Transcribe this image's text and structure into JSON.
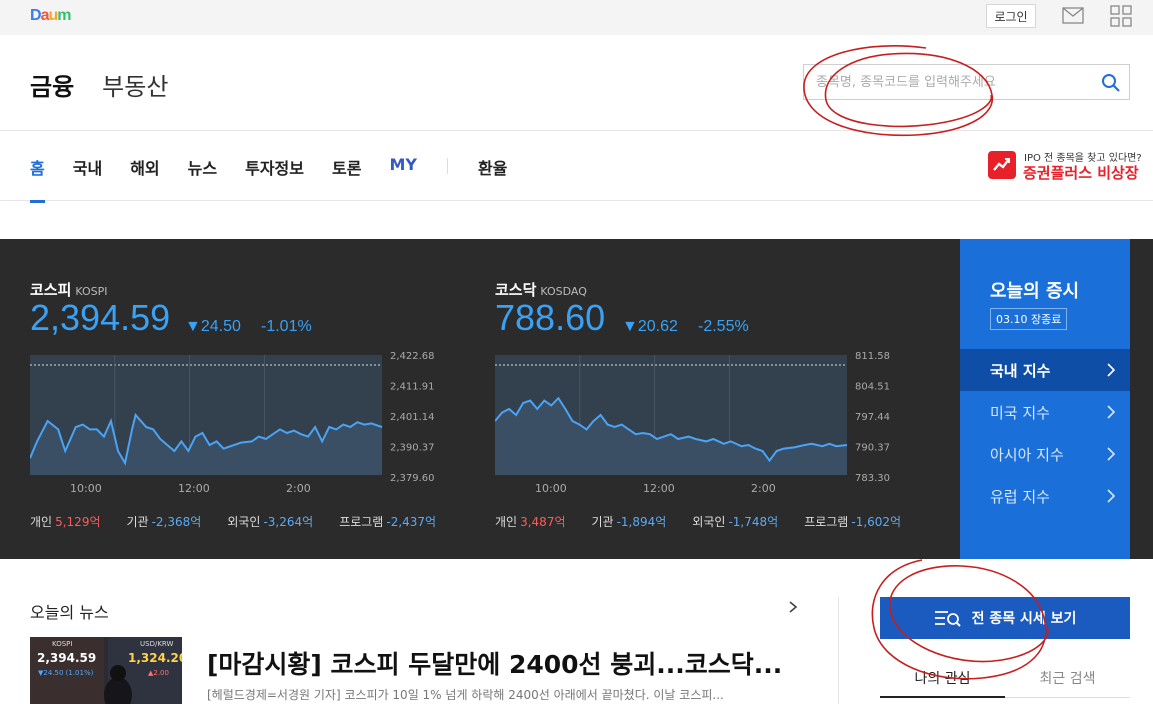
{
  "topbar": {
    "logo": [
      "D",
      "a",
      "u",
      "m"
    ],
    "login_label": "로그인"
  },
  "header": {
    "nav_finance": "금융",
    "nav_realestate": "부동산",
    "search_placeholder": "종목명, 종목코드를 입력해주세요"
  },
  "subnav": {
    "tabs": [
      "홈",
      "국내",
      "해외",
      "뉴스",
      "투자정보",
      "토론",
      "MY",
      "환율"
    ],
    "promo_top": "IPO 전 종목을 찾고 있다면?",
    "promo_main": "증권플러스 비상장"
  },
  "colors": {
    "accent": "#1b6fd8",
    "up": "#ff5a5a",
    "down": "#39a2f5",
    "panel": "#2b2b2b"
  },
  "kospi": {
    "name": "코스피",
    "code": "KOSPI",
    "value": "2,394.59",
    "change": "▼24.50",
    "change_pct": "-1.01%",
    "y_ticks": [
      "2,422.68",
      "2,411.91",
      "2,401.14",
      "2,390.37",
      "2,379.60"
    ],
    "x_ticks": [
      "10:00",
      "12:00",
      "2:00"
    ],
    "flows": [
      {
        "label": "개인",
        "value": "5,129억",
        "dir": "up"
      },
      {
        "label": "기관",
        "value": "-2,368억",
        "dir": "down"
      },
      {
        "label": "외국인",
        "value": "-3,264억",
        "dir": "down"
      },
      {
        "label": "프로그램",
        "value": "-2,437억",
        "dir": "down"
      }
    ]
  },
  "kosdaq": {
    "name": "코스닥",
    "code": "KOSDAQ",
    "value": "788.60",
    "change": "▼20.62",
    "change_pct": "-2.55%",
    "y_ticks": [
      "811.58",
      "804.51",
      "797.44",
      "790.37",
      "783.30"
    ],
    "x_ticks": [
      "10:00",
      "12:00",
      "2:00"
    ],
    "flows": [
      {
        "label": "개인",
        "value": "3,487억",
        "dir": "up"
      },
      {
        "label": "기관",
        "value": "-1,894억",
        "dir": "down"
      },
      {
        "label": "외국인",
        "value": "-1,748억",
        "dir": "down"
      },
      {
        "label": "프로그램",
        "value": "-1,602억",
        "dir": "down"
      }
    ]
  },
  "today": {
    "title": "오늘의 증시",
    "badge": "03.10 장종료",
    "items": [
      "국내 지수",
      "미국 지수",
      "아시아 지수",
      "유럽 지수"
    ]
  },
  "news": {
    "section_title": "오늘의 뉴스",
    "headline": "[마감시황] 코스피 두달만에 2400선 붕괴...코스닥...",
    "snippet": "[헤럴드경제=서경원 기자] 코스피가 10일 1% 넘게 하락해 2400선 아래에서 끝마쳤다. 이날 코스피...",
    "thumb": {
      "label1": "KOSPI",
      "value1": "2,394.59",
      "change1": "▼24.50 (1.01%)",
      "label2": "USD/KRW",
      "value2": "1,324.20",
      "change2": "▲2.00"
    }
  },
  "side": {
    "all_button": "전 종목 시세 보기",
    "tab_my": "나의 관심",
    "tab_recent": "최근 검색"
  }
}
